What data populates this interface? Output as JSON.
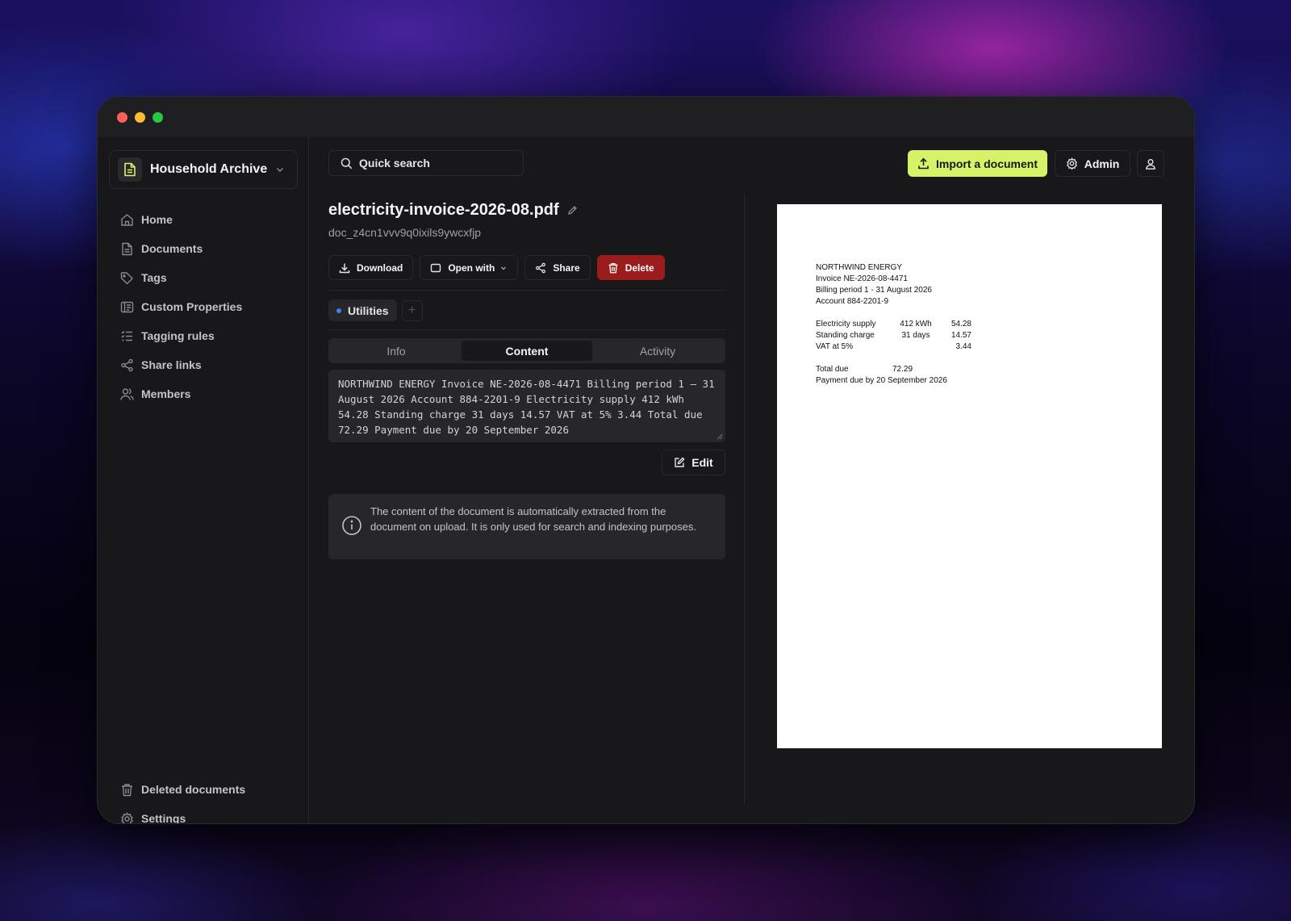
{
  "workspace": {
    "name": "Household Archive"
  },
  "sidebar": {
    "items": [
      {
        "label": "Home",
        "icon": "home-icon"
      },
      {
        "label": "Documents",
        "icon": "document-icon"
      },
      {
        "label": "Tags",
        "icon": "tag-icon"
      },
      {
        "label": "Custom Properties",
        "icon": "properties-icon"
      },
      {
        "label": "Tagging rules",
        "icon": "list-icon"
      },
      {
        "label": "Share links",
        "icon": "share-icon"
      },
      {
        "label": "Members",
        "icon": "users-icon"
      }
    ],
    "bottom_items": [
      {
        "label": "Deleted documents",
        "icon": "trash-icon"
      },
      {
        "label": "Settings",
        "icon": "gear-icon"
      }
    ]
  },
  "header": {
    "search_label": "Quick search",
    "import_label": "Import a document",
    "admin_label": "Admin"
  },
  "document": {
    "title": "electricity-invoice-2026-08.pdf",
    "id": "doc_z4cn1vvv9q0ixils9ywcxfjp",
    "actions": {
      "download": "Download",
      "open_with": "Open with",
      "share": "Share",
      "delete": "Delete"
    },
    "tags": [
      {
        "label": "Utilities",
        "color": "#3b82f6"
      }
    ],
    "tabs": [
      {
        "label": "Info",
        "active": false
      },
      {
        "label": "Content",
        "active": true
      },
      {
        "label": "Activity",
        "active": false
      }
    ],
    "content_text": "NORTHWIND ENERGY Invoice NE-2026-08-4471 Billing period 1 – 31 August 2026 Account 884-2201-9 Electricity supply 412 kWh 54.28 Standing charge 31 days 14.57 VAT at 5% 3.44 Total due 72.29 Payment due by 20 September 2026",
    "edit_label": "Edit",
    "info_text": "The content of the document is automatically extracted from the document on upload. It is only used for search and indexing purposes."
  },
  "preview": {
    "company": "NORTHWIND ENERGY",
    "invoice": "Invoice  NE-2026-08-4471",
    "billing": "Billing period  1 - 31 August 2026",
    "account": "Account  884-2201-9",
    "lines": [
      {
        "label": "Electricity supply",
        "qty": "412 kWh",
        "amount": "54.28"
      },
      {
        "label": "Standing charge",
        "qty": "31 days",
        "amount": "14.57"
      },
      {
        "label": "VAT at 5%",
        "qty": "",
        "amount": "3.44"
      }
    ],
    "total_label": "Total due",
    "total_value": "72.29",
    "payment_due": "Payment due by 20 September 2026"
  },
  "colors": {
    "accent": "#d6f269",
    "danger": "#9b1c1c"
  }
}
